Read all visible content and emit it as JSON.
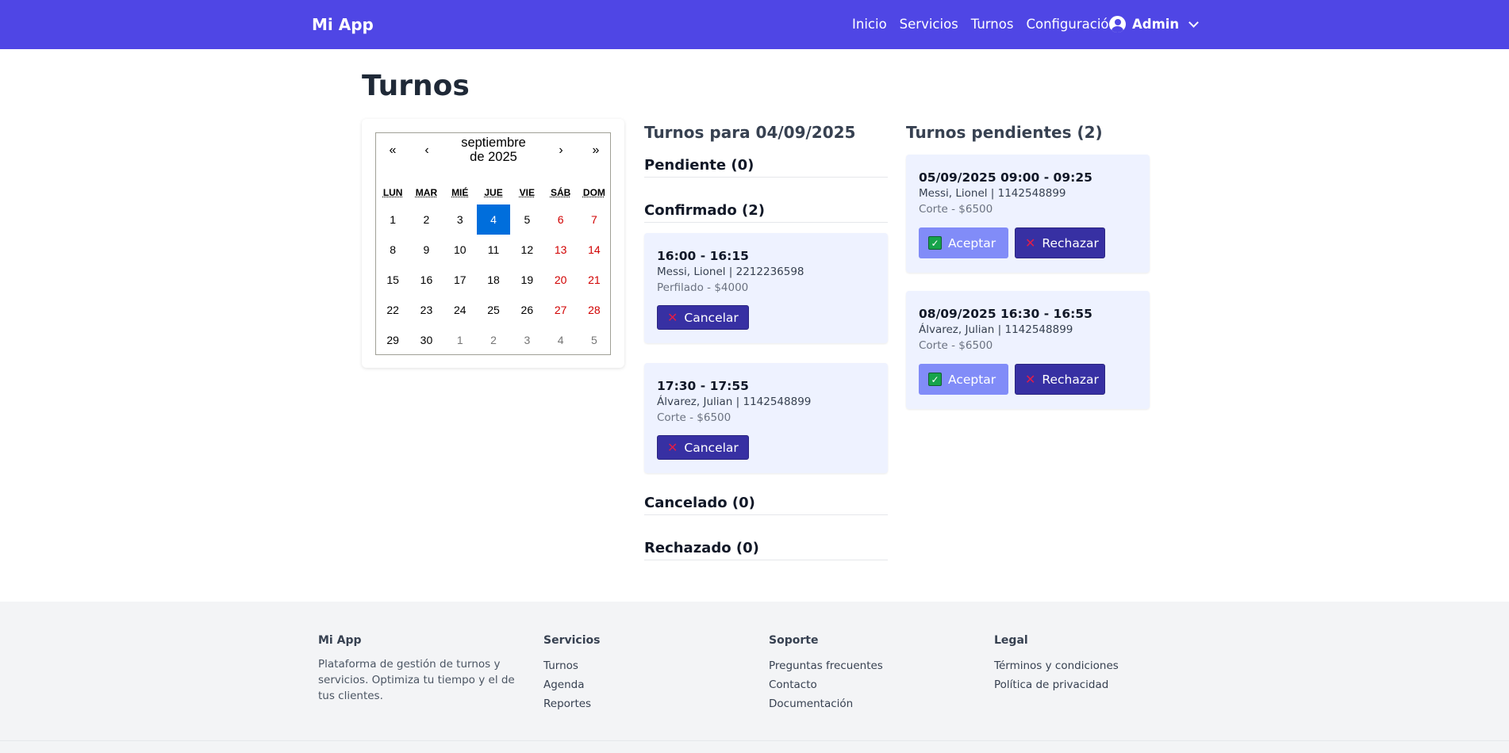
{
  "navbar": {
    "brand": "Mi App",
    "links": [
      "Inicio",
      "Servicios",
      "Turnos",
      "Configuración"
    ],
    "user": "Admin"
  },
  "page": {
    "title": "Turnos"
  },
  "calendar": {
    "prev_year": "«",
    "prev_month": "‹",
    "label": "septiembre de 2025",
    "next_month": "›",
    "next_year": "»",
    "weekdays": [
      "LUN",
      "MAR",
      "MIÉ",
      "JUE",
      "VIE",
      "SÁB",
      "DOM"
    ],
    "days": [
      "1",
      "2",
      "3",
      "4",
      "5",
      "6",
      "7",
      "8",
      "9",
      "10",
      "11",
      "12",
      "13",
      "14",
      "15",
      "16",
      "17",
      "18",
      "19",
      "20",
      "21",
      "22",
      "23",
      "24",
      "25",
      "26",
      "27",
      "28",
      "29",
      "30",
      "1",
      "2",
      "3",
      "4",
      "5"
    ],
    "selected_day": "4"
  },
  "day_view": {
    "title": "Turnos para 04/09/2025",
    "sections": {
      "pending": "Pendiente (0)",
      "confirmed": "Confirmado (2)",
      "cancelled": "Cancelado (0)",
      "rejected": "Rechazado (0)"
    },
    "confirmed": [
      {
        "time": "16:00 - 16:15",
        "client": "Messi, Lionel | 2212236598",
        "service": "Perfilado - $4000",
        "cancel_label": "Cancelar"
      },
      {
        "time": "17:30 - 17:55",
        "client": "Álvarez, Julian | 1142548899",
        "service": "Corte - $6500",
        "cancel_label": "Cancelar"
      }
    ]
  },
  "pending_view": {
    "title": "Turnos pendientes (2)",
    "items": [
      {
        "time": "05/09/2025 09:00 - 09:25",
        "client": "Messi, Lionel | 1142548899",
        "service": "Corte - $6500",
        "accept_label": "Aceptar",
        "reject_label": "Rechazar"
      },
      {
        "time": "08/09/2025 16:30 - 16:55",
        "client": "Álvarez, Julian | 1142548899",
        "service": "Corte - $6500",
        "accept_label": "Aceptar",
        "reject_label": "Rechazar"
      }
    ]
  },
  "footer": {
    "about": {
      "title": "Mi App",
      "text": "Plataforma de gestión de turnos y servicios. Optimiza tu tiempo y el de tus clientes."
    },
    "services": {
      "title": "Servicios",
      "links": [
        "Turnos",
        "Agenda",
        "Reportes"
      ]
    },
    "support": {
      "title": "Soporte",
      "links": [
        "Preguntas frecuentes",
        "Contacto",
        "Documentación"
      ]
    },
    "legal": {
      "title": "Legal",
      "links": [
        "Términos y condiciones",
        "Política de privacidad"
      ]
    }
  },
  "colors": {
    "navbar": "#4f46e5",
    "card_bg": "#eef2ff",
    "button_dark": "#3730a3",
    "button_light": "#818cf8",
    "calendar_selected": "#006edc",
    "weekend": "#d10000"
  }
}
